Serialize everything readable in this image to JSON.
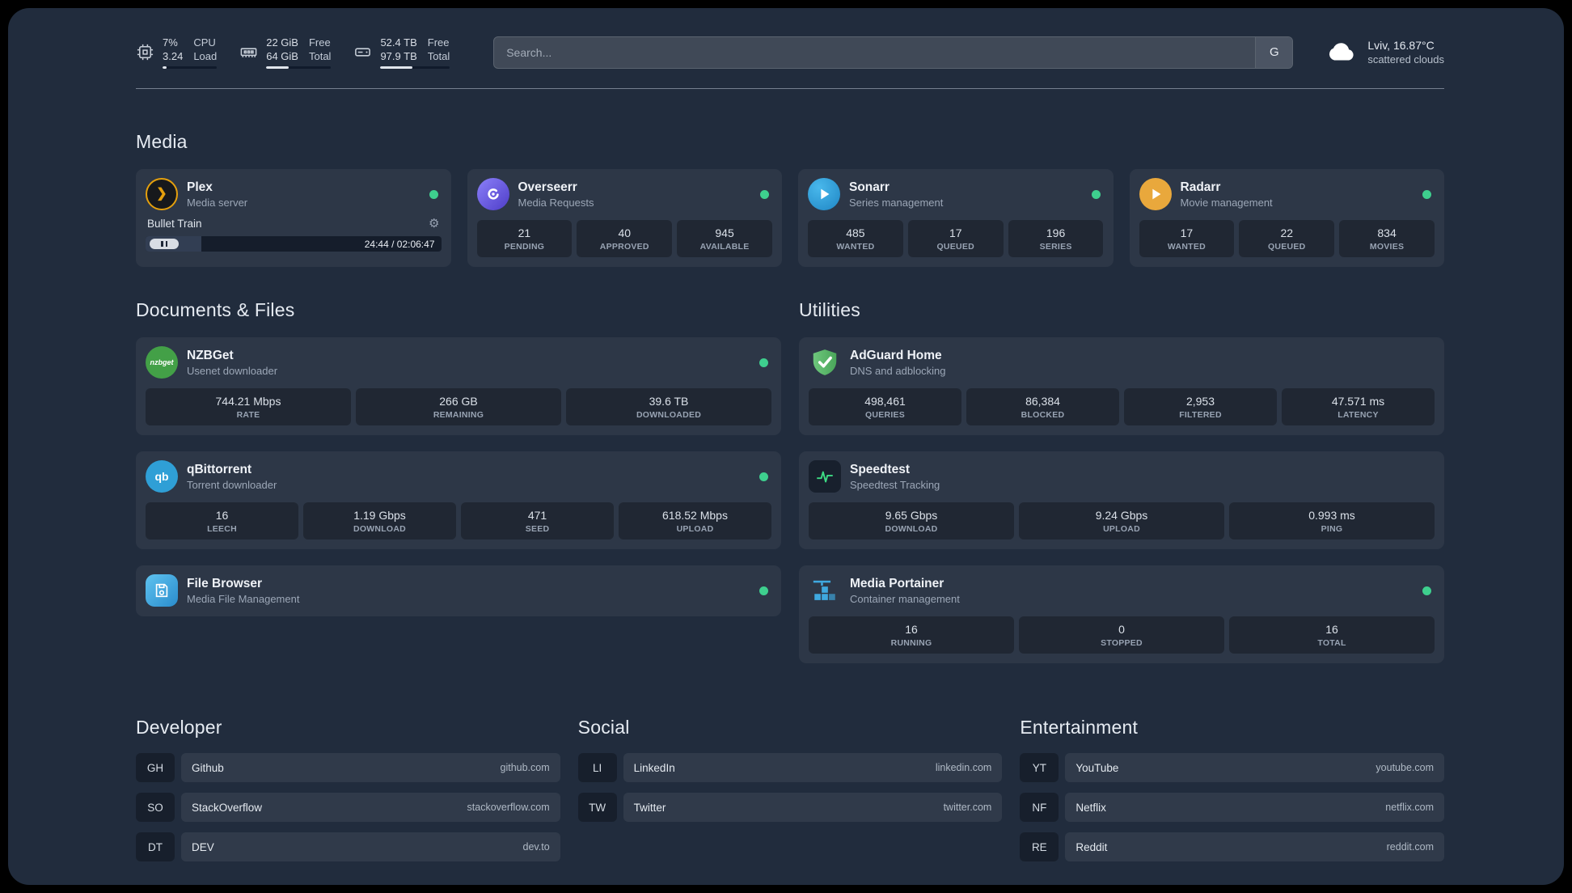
{
  "colors": {
    "status_online": "#3ecf8e",
    "accent_plex": "#e5a00d",
    "accent_overseerr": "#6c5ce7",
    "accent_sonarr": "#35a8e0",
    "accent_radarr": "#e9a83c",
    "accent_nzbget": "#43a047",
    "accent_qbittorrent": "#2f9fd6",
    "accent_filebrowser": "#3ea2dd",
    "accent_adguard": "#5fba6e",
    "accent_speedtest": "#3ddc84",
    "accent_portainer": "#3fa9e0"
  },
  "topbar": {
    "resources": [
      {
        "name": "cpu",
        "values": [
          "7%",
          "3.24"
        ],
        "labels": [
          "CPU",
          "Load"
        ],
        "percent": 7
      },
      {
        "name": "memory",
        "values": [
          "22 GiB",
          "64 GiB"
        ],
        "labels": [
          "Free",
          "Total"
        ],
        "percent": 34
      },
      {
        "name": "disk",
        "values": [
          "52.4 TB",
          "97.9 TB"
        ],
        "labels": [
          "Free",
          "Total"
        ],
        "percent": 46
      }
    ],
    "search": {
      "placeholder": "Search...",
      "provider_label": "G"
    },
    "weather": {
      "location": "Lviv, 16.87°C",
      "condition": "scattered clouds"
    }
  },
  "sections": {
    "media": {
      "title": "Media",
      "cards": [
        {
          "name": "Plex",
          "desc": "Media server",
          "player": {
            "track": "Bullet Train",
            "time": "24:44 / 02:06:47",
            "progress_percent": 19
          }
        },
        {
          "name": "Overseerr",
          "desc": "Media Requests",
          "stats": [
            {
              "value": "21",
              "label": "PENDING"
            },
            {
              "value": "40",
              "label": "APPROVED"
            },
            {
              "value": "945",
              "label": "AVAILABLE"
            }
          ]
        },
        {
          "name": "Sonarr",
          "desc": "Series management",
          "stats": [
            {
              "value": "485",
              "label": "WANTED"
            },
            {
              "value": "17",
              "label": "QUEUED"
            },
            {
              "value": "196",
              "label": "SERIES"
            }
          ]
        },
        {
          "name": "Radarr",
          "desc": "Movie management",
          "stats": [
            {
              "value": "17",
              "label": "WANTED"
            },
            {
              "value": "22",
              "label": "QUEUED"
            },
            {
              "value": "834",
              "label": "MOVIES"
            }
          ]
        }
      ]
    },
    "documents": {
      "title": "Documents & Files",
      "cards": [
        {
          "name": "NZBGet",
          "desc": "Usenet downloader",
          "icon_text": "nzbget",
          "stats": [
            {
              "value": "744.21 Mbps",
              "label": "RATE"
            },
            {
              "value": "266 GB",
              "label": "REMAINING"
            },
            {
              "value": "39.6 TB",
              "label": "DOWNLOADED"
            }
          ]
        },
        {
          "name": "qBittorrent",
          "desc": "Torrent downloader",
          "icon_text": "qb",
          "stats": [
            {
              "value": "16",
              "label": "LEECH"
            },
            {
              "value": "1.19 Gbps",
              "label": "DOWNLOAD"
            },
            {
              "value": "471",
              "label": "SEED"
            },
            {
              "value": "618.52 Mbps",
              "label": "UPLOAD"
            }
          ]
        },
        {
          "name": "File Browser",
          "desc": "Media File Management"
        }
      ]
    },
    "utilities": {
      "title": "Utilities",
      "cards": [
        {
          "name": "AdGuard Home",
          "desc": "DNS and adblocking",
          "stats": [
            {
              "value": "498,461",
              "label": "QUERIES"
            },
            {
              "value": "86,384",
              "label": "BLOCKED"
            },
            {
              "value": "2,953",
              "label": "FILTERED"
            },
            {
              "value": "47.571 ms",
              "label": "LATENCY"
            }
          ]
        },
        {
          "name": "Speedtest",
          "desc": "Speedtest Tracking",
          "stats": [
            {
              "value": "9.65 Gbps",
              "label": "DOWNLOAD"
            },
            {
              "value": "9.24 Gbps",
              "label": "UPLOAD"
            },
            {
              "value": "0.993 ms",
              "label": "PING"
            }
          ]
        },
        {
          "name": "Media Portainer",
          "desc": "Container management",
          "stats": [
            {
              "value": "16",
              "label": "RUNNING"
            },
            {
              "value": "0",
              "label": "STOPPED"
            },
            {
              "value": "16",
              "label": "TOTAL"
            }
          ]
        }
      ]
    },
    "bookmarks": [
      {
        "title": "Developer",
        "items": [
          {
            "abbr": "GH",
            "name": "Github",
            "url": "github.com"
          },
          {
            "abbr": "SO",
            "name": "StackOverflow",
            "url": "stackoverflow.com"
          },
          {
            "abbr": "DT",
            "name": "DEV",
            "url": "dev.to"
          }
        ]
      },
      {
        "title": "Social",
        "items": [
          {
            "abbr": "LI",
            "name": "LinkedIn",
            "url": "linkedin.com"
          },
          {
            "abbr": "TW",
            "name": "Twitter",
            "url": "twitter.com"
          }
        ]
      },
      {
        "title": "Entertainment",
        "items": [
          {
            "abbr": "YT",
            "name": "YouTube",
            "url": "youtube.com"
          },
          {
            "abbr": "NF",
            "name": "Netflix",
            "url": "netflix.com"
          },
          {
            "abbr": "RE",
            "name": "Reddit",
            "url": "reddit.com"
          }
        ]
      }
    ]
  }
}
